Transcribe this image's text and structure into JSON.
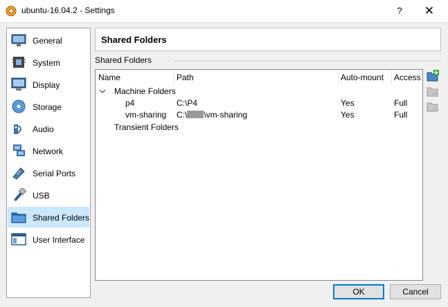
{
  "window": {
    "title": "ubuntu-16.04.2 - Settings",
    "help_label": "?",
    "close_label": "✕"
  },
  "sidebar": {
    "items": [
      {
        "label": "General",
        "icon": "monitor-icon"
      },
      {
        "label": "System",
        "icon": "chip-icon"
      },
      {
        "label": "Display",
        "icon": "display-icon"
      },
      {
        "label": "Storage",
        "icon": "storage-icon"
      },
      {
        "label": "Audio",
        "icon": "audio-icon"
      },
      {
        "label": "Network",
        "icon": "network-icon"
      },
      {
        "label": "Serial Ports",
        "icon": "serial-port-icon"
      },
      {
        "label": "USB",
        "icon": "usb-icon"
      },
      {
        "label": "Shared Folders",
        "icon": "folder-icon",
        "selected": true
      },
      {
        "label": "User Interface",
        "icon": "window-icon"
      }
    ]
  },
  "header": {
    "title": "Shared Folders"
  },
  "group": {
    "label": "Shared Folders"
  },
  "table": {
    "columns": [
      "Name",
      "Path",
      "Auto-mount",
      "Access"
    ],
    "machine_group": "Machine Folders",
    "rows": [
      {
        "name": "p4",
        "path": "C:\\P4",
        "automount": "Yes",
        "access": "Full"
      },
      {
        "name": "vm-sharing",
        "path_prefix": "C:\\",
        "path_suffix": "\\vm-sharing",
        "automount": "Yes",
        "access": "Full"
      }
    ],
    "transient_group": "Transient Folders"
  },
  "buttons": {
    "ok": "OK",
    "cancel": "Cancel"
  },
  "colors": {
    "selection": "#cce8ff",
    "default_button_border": "#0078d7"
  }
}
